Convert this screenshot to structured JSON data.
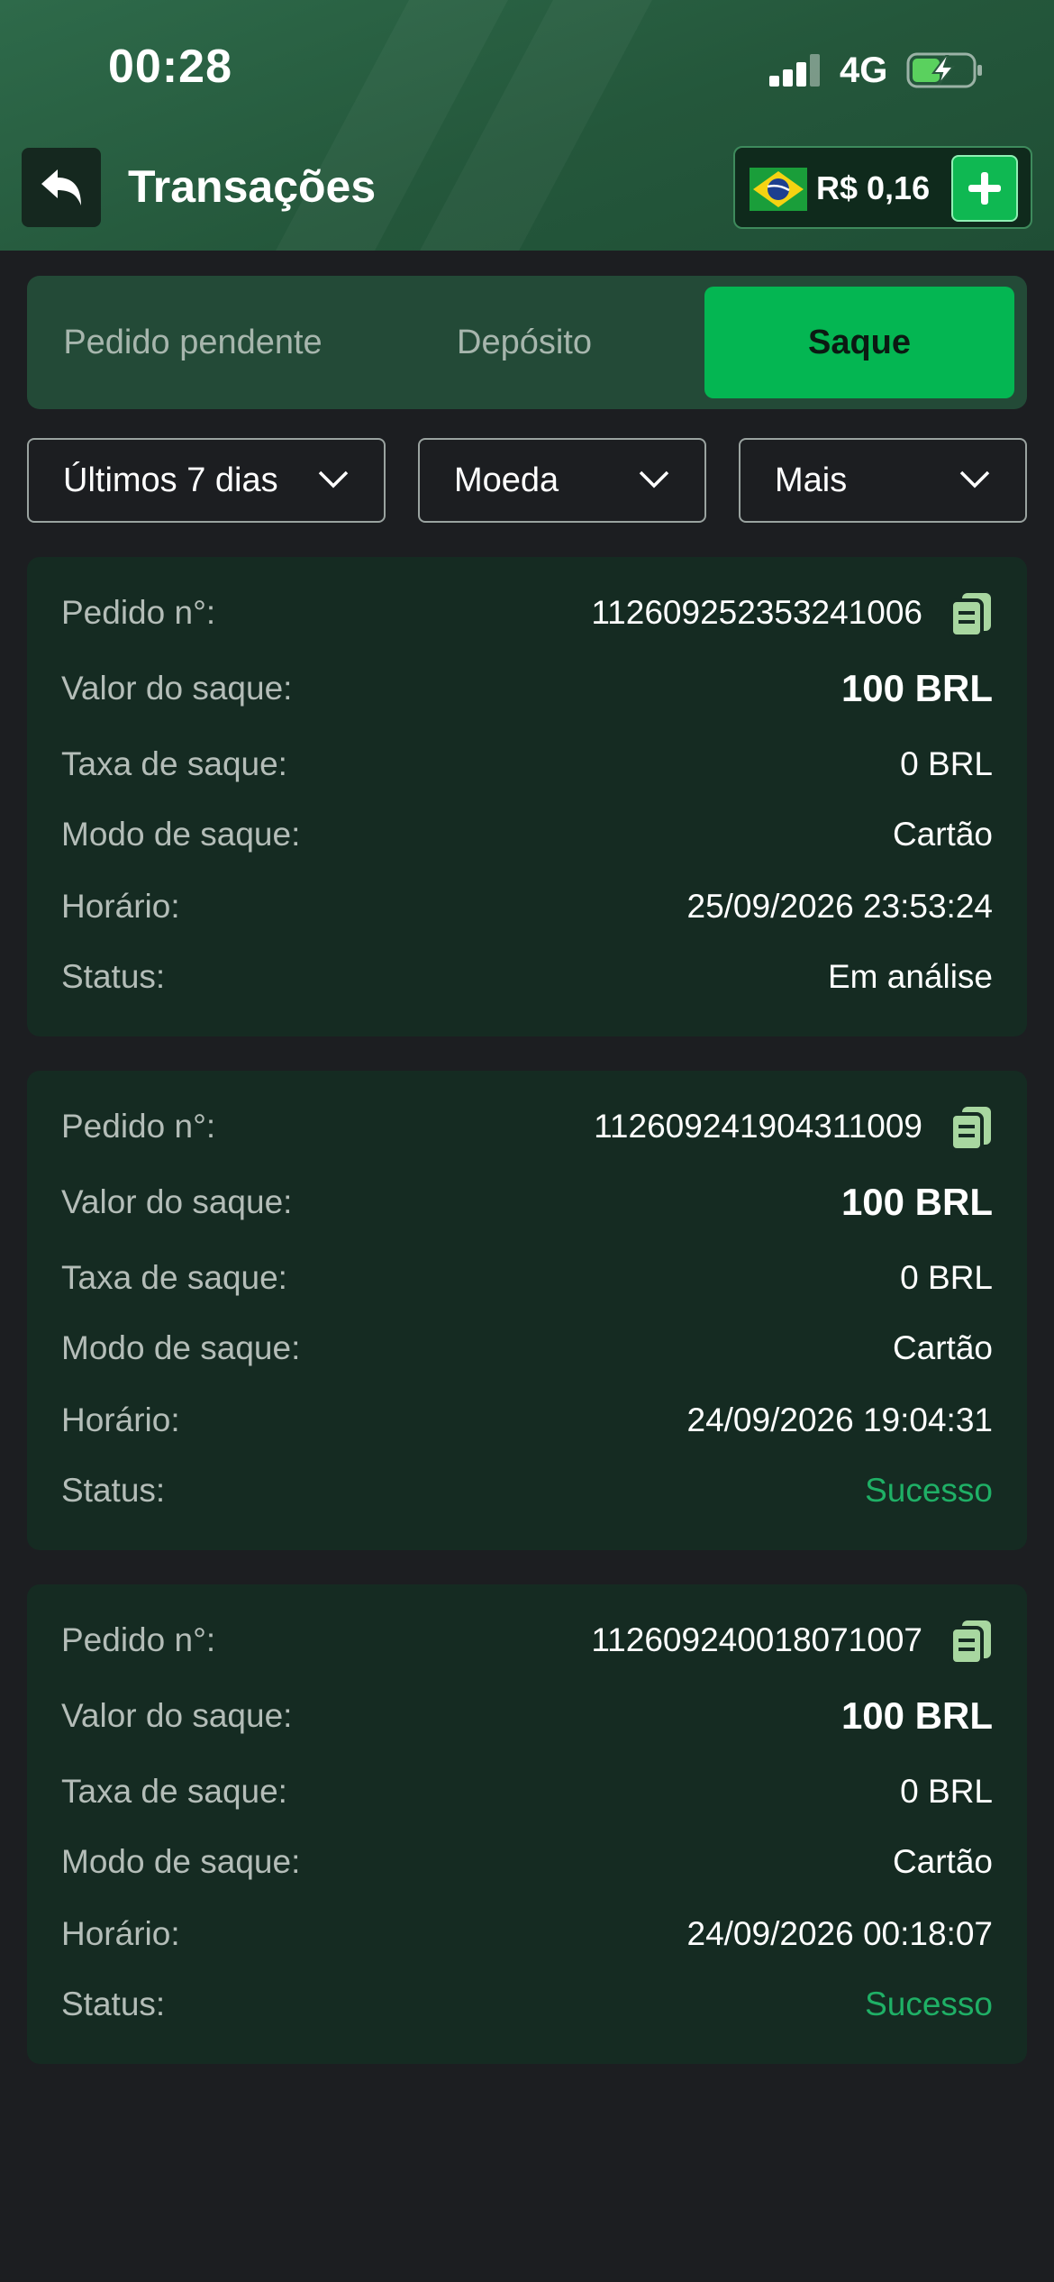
{
  "status_bar": {
    "time": "00:28",
    "network": "4G"
  },
  "header": {
    "title": "Transações",
    "balance": "R$ 0,16"
  },
  "tabs": [
    {
      "label": "Pedido pendente",
      "active": false
    },
    {
      "label": "Depósito",
      "active": false
    },
    {
      "label": "Saque",
      "active": true
    }
  ],
  "filters": [
    {
      "label": "Últimos 7 dias"
    },
    {
      "label": "Moeda"
    },
    {
      "label": "Mais"
    }
  ],
  "labels": {
    "order": "Pedido n°:",
    "amount": "Valor do saque:",
    "fee": "Taxa de saque:",
    "mode": "Modo de saque:",
    "time": "Horário:",
    "status": "Status:"
  },
  "transactions": [
    {
      "order_no": "112609252353241006",
      "amount": "100 BRL",
      "fee": "0 BRL",
      "mode": "Cartão",
      "time": "25/09/2026 23:53:24",
      "status": "Em análise"
    },
    {
      "order_no": "112609241904311009",
      "amount": "100 BRL",
      "fee": "0 BRL",
      "mode": "Cartão",
      "time": "24/09/2026 19:04:31",
      "status": "Sucesso"
    },
    {
      "order_no": "112609240018071007",
      "amount": "100 BRL",
      "fee": "0 BRL",
      "mode": "Cartão",
      "time": "24/09/2026 00:18:07",
      "status": "Sucesso"
    }
  ],
  "colors": {
    "accent": "#04b652",
    "success": "#1fb066",
    "card_bg": "#152b22",
    "page_bg": "#1c1e21"
  },
  "icons": [
    "back-arrow-icon",
    "brazil-flag-icon",
    "plus-icon",
    "chevron-down-icon",
    "copy-icon"
  ]
}
